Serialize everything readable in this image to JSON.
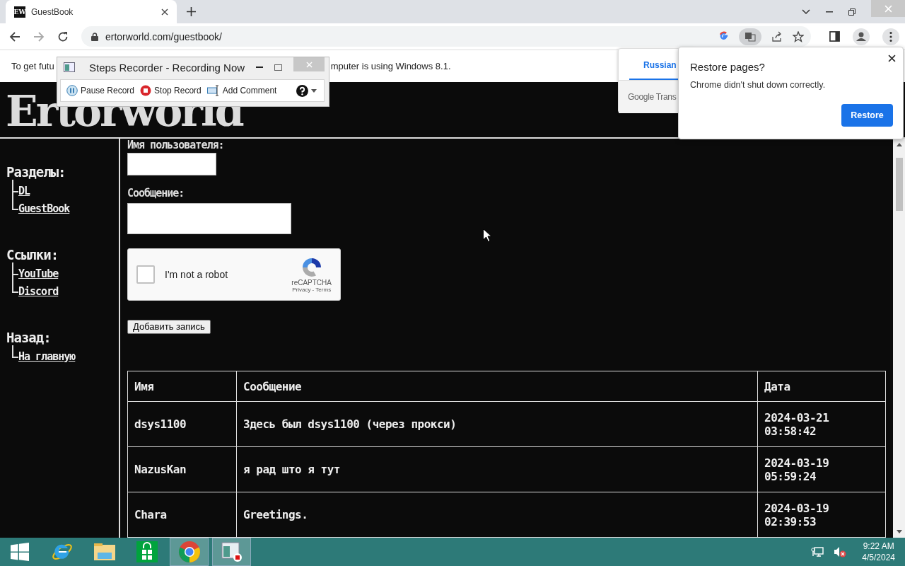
{
  "browser": {
    "tab": {
      "title": "GuestBook",
      "favicon": "EW",
      "selected": true
    },
    "address": "ertorworld.com/guestbook/"
  },
  "infobar": {
    "text_before": "To get futu",
    "text_after": "mputer is using Windows 8.1."
  },
  "steps_recorder": {
    "title": "Steps Recorder - Recording Now",
    "buttons": [
      {
        "label": "Pause Record",
        "kind": "pause"
      },
      {
        "label": "Stop Record",
        "kind": "stop"
      },
      {
        "label": "Add Comment",
        "kind": "comment"
      }
    ]
  },
  "translate_popup": {
    "tabs": [
      {
        "label": "Russian",
        "selected": true
      }
    ],
    "footer": "Google Trans"
  },
  "restore_dialog": {
    "title": "Restore pages?",
    "message": "Chrome didn't shut down correctly.",
    "button": "Restore"
  },
  "site": {
    "logo": "Ertorworld",
    "sidebar": [
      {
        "heading": "Разделы:",
        "links": [
          "DL",
          "GuestBook"
        ]
      },
      {
        "heading": "Ссылки:",
        "links": [
          "YouTube",
          "Discord"
        ]
      },
      {
        "heading": "Назад:",
        "links": [
          "На главную"
        ]
      }
    ],
    "form": {
      "name_label": "Имя пользователя:",
      "message_label": "Сообщение:",
      "captcha": {
        "label": "I'm not a robot",
        "checked": false,
        "brand": "reCAPTCHA",
        "links": "Privacy - Terms"
      },
      "submit": "Добавить запись"
    },
    "table": {
      "columns": [
        "Имя",
        "Сообщение",
        "Дата"
      ],
      "rows": [
        {
          "name": "dsys1100",
          "message": "Здесь был dsys1100 (через прокси)",
          "date": "2024-03-21",
          "time": "03:58:42"
        },
        {
          "name": "NazusKan",
          "message": "я рад што я тут",
          "date": "2024-03-19",
          "time": "05:59:24"
        },
        {
          "name": "Chara",
          "message": "Greetings.",
          "date": "2024-03-19",
          "time": "02:39:53"
        }
      ]
    }
  },
  "taskbar": {
    "apps": [
      {
        "kind": "start",
        "selected": false
      },
      {
        "kind": "ie",
        "selected": false
      },
      {
        "kind": "explorer",
        "selected": false
      },
      {
        "kind": "store",
        "selected": false
      },
      {
        "kind": "chrome",
        "selected": true
      },
      {
        "kind": "steps",
        "selected": true
      }
    ],
    "clock": {
      "time": "9:22 AM",
      "date": "4/5/2024"
    }
  }
}
